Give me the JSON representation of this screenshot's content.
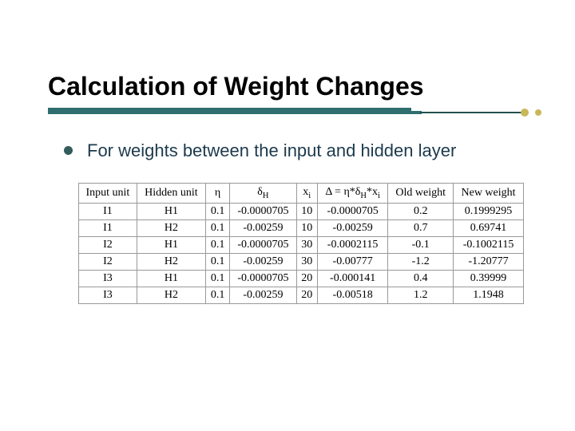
{
  "title": "Calculation of Weight Changes",
  "bullet": "For weights between the input and hidden layer",
  "table": {
    "headers": {
      "input_unit": "Input unit",
      "hidden_unit": "Hidden unit",
      "eta": "η",
      "delta_h_label": "δ",
      "delta_h_sub": "H",
      "xi_label": "x",
      "xi_sub": "i",
      "change_prefix": "Δ = η*δ",
      "change_sub1": "H",
      "change_mid": "*x",
      "change_sub2": "i",
      "old_weight": "Old weight",
      "new_weight": "New weight"
    },
    "rows": [
      {
        "input": "I1",
        "hidden": "H1",
        "eta": "0.1",
        "dH": "-0.0000705",
        "xi": "10",
        "delta": "-0.0000705",
        "old": "0.2",
        "new": "0.1999295"
      },
      {
        "input": "I1",
        "hidden": "H2",
        "eta": "0.1",
        "dH": "-0.00259",
        "xi": "10",
        "delta": "-0.00259",
        "old": "0.7",
        "new": "0.69741"
      },
      {
        "input": "I2",
        "hidden": "H1",
        "eta": "0.1",
        "dH": "-0.0000705",
        "xi": "30",
        "delta": "-0.0002115",
        "old": "-0.1",
        "new": "-0.1002115"
      },
      {
        "input": "I2",
        "hidden": "H2",
        "eta": "0.1",
        "dH": "-0.00259",
        "xi": "30",
        "delta": "-0.00777",
        "old": "-1.2",
        "new": "-1.20777"
      },
      {
        "input": "I3",
        "hidden": "H1",
        "eta": "0.1",
        "dH": "-0.0000705",
        "xi": "20",
        "delta": "-0.000141",
        "old": "0.4",
        "new": "0.39999"
      },
      {
        "input": "I3",
        "hidden": "H2",
        "eta": "0.1",
        "dH": "-0.00259",
        "xi": "20",
        "delta": "-0.00518",
        "old": "1.2",
        "new": "1.1948"
      }
    ]
  },
  "chart_data": {
    "type": "table",
    "title": "Calculation of Weight Changes",
    "columns": [
      "Input unit",
      "Hidden unit",
      "η",
      "δ_H",
      "x_i",
      "Δ = η*δ_H*x_i",
      "Old weight",
      "New weight"
    ],
    "rows": [
      [
        "I1",
        "H1",
        0.1,
        -7.05e-05,
        10,
        -7.05e-05,
        0.2,
        0.1999295
      ],
      [
        "I1",
        "H2",
        0.1,
        -0.00259,
        10,
        -0.00259,
        0.7,
        0.69741
      ],
      [
        "I2",
        "H1",
        0.1,
        -7.05e-05,
        30,
        -0.0002115,
        -0.1,
        -0.1002115
      ],
      [
        "I2",
        "H2",
        0.1,
        -0.00259,
        30,
        -0.00777,
        -1.2,
        -1.20777
      ],
      [
        "I3",
        "H1",
        0.1,
        -7.05e-05,
        20,
        -0.000141,
        0.4,
        0.39999
      ],
      [
        "I3",
        "H2",
        0.1,
        -0.00259,
        20,
        -0.00518,
        1.2,
        1.1948
      ]
    ]
  }
}
